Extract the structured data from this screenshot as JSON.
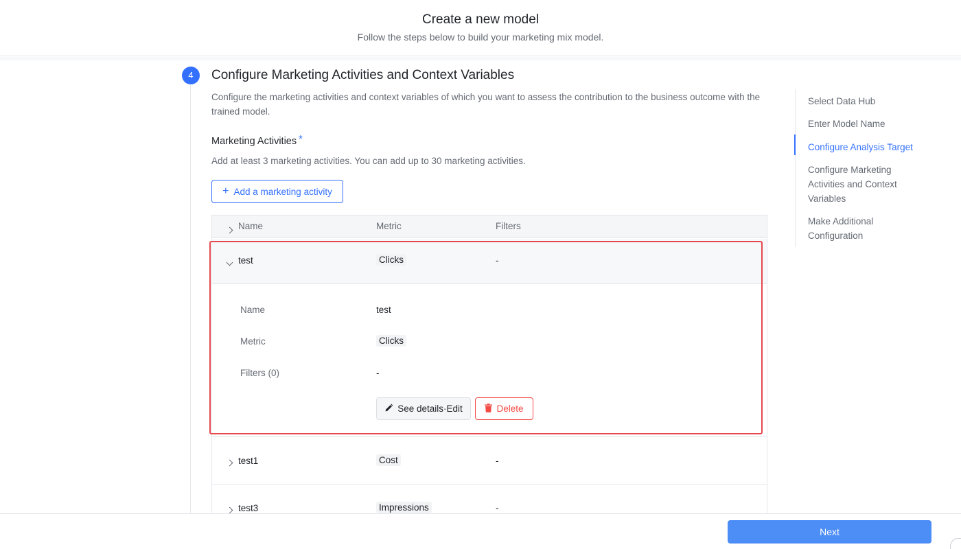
{
  "header": {
    "title": "Create a new model",
    "subtitle": "Follow the steps below to build your marketing mix model."
  },
  "step": {
    "number": "4",
    "title": "Configure Marketing Activities and Context Variables",
    "description": "Configure the marketing activities and context variables of which you want to assess the contribution to the business outcome with the trained model."
  },
  "marketing": {
    "label": "Marketing Activities",
    "required_mark": "*",
    "hint": "Add at least 3 marketing activities. You can add up to 30 marketing activities.",
    "add_button": "Add a marketing activity",
    "add_icon": "+"
  },
  "table": {
    "columns": [
      "Name",
      "Metric",
      "Filters"
    ],
    "rows": [
      {
        "name": "test",
        "metric": "Clicks",
        "filters": "-",
        "expanded": true
      },
      {
        "name": "test1",
        "metric": "Cost",
        "filters": "-",
        "expanded": false
      },
      {
        "name": "test3",
        "metric": "Impressions",
        "filters": "-",
        "expanded": false
      }
    ],
    "detail": {
      "name_label": "Name",
      "name_value": "test",
      "metric_label": "Metric",
      "metric_value": "Clicks",
      "filters_label": "Filters (0)",
      "filters_value": "-",
      "edit_button": "See details·Edit",
      "delete_button": "Delete"
    }
  },
  "toc": {
    "items": [
      "Select Data Hub",
      "Enter Model Name",
      "Configure Analysis Target",
      "Configure Marketing Activities and Context Variables",
      "Make Additional Configuration"
    ],
    "active_index": 2
  },
  "footer": {
    "next_button": "Next"
  },
  "colors": {
    "accent": "#3370ff",
    "danger": "#f54a45",
    "highlight": "#e5484d",
    "next_button": "#4c8df6"
  }
}
